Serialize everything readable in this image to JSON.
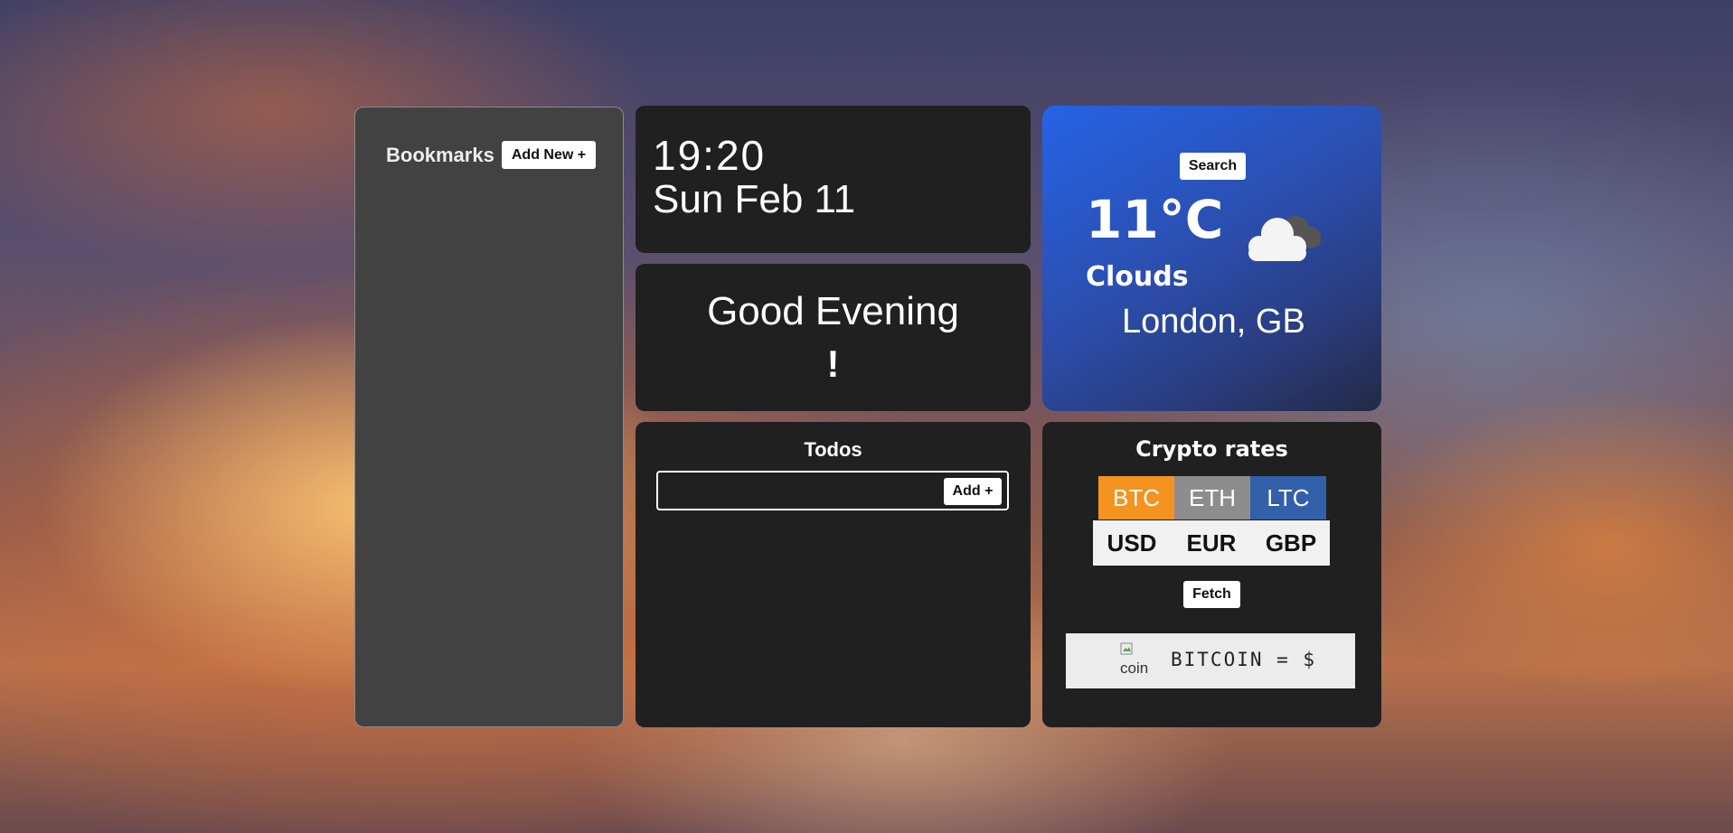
{
  "bookmarks": {
    "title": "Bookmarks",
    "add_label": "Add New +"
  },
  "clock": {
    "time": "19:20",
    "date": "Sun Feb 11"
  },
  "greeting": {
    "line1": "Good Evening",
    "line2": "!"
  },
  "weather": {
    "search_label": "Search",
    "temperature": "11°C",
    "condition": "Clouds",
    "location": "London, GB",
    "icon": "cloud-icon"
  },
  "todos": {
    "title": "Todos",
    "input_value": "",
    "add_label": "Add +"
  },
  "crypto": {
    "title": "Crypto rates",
    "coins": [
      {
        "label": "BTC",
        "color": "#f49320"
      },
      {
        "label": "ETH",
        "color": "#8d8d8d"
      },
      {
        "label": "LTC",
        "color": "#3260aa"
      }
    ],
    "currencies": [
      "USD",
      "EUR",
      "GBP"
    ],
    "fetch_label": "Fetch",
    "coin_image_alt": "coin",
    "rate_text": "BITCOIN = $"
  }
}
